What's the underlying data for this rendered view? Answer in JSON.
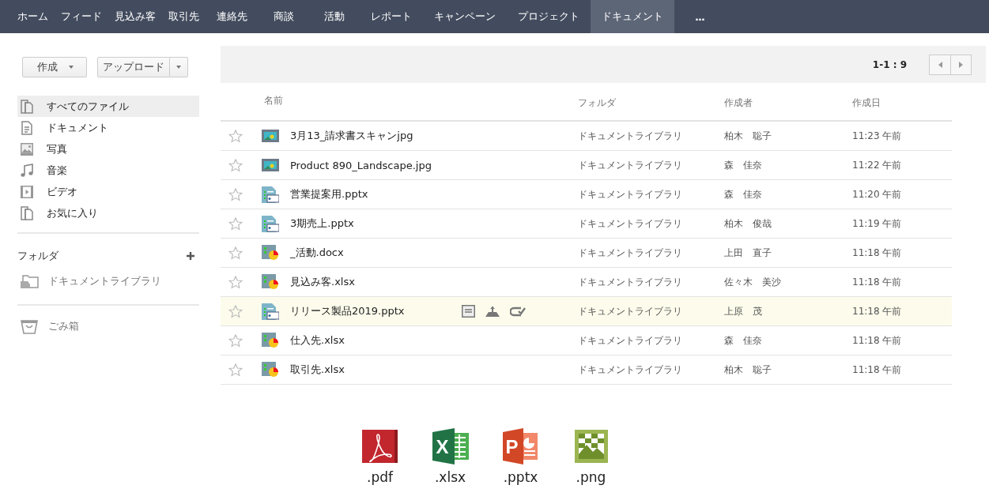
{
  "nav": {
    "items": [
      {
        "label": "ホーム",
        "selected": false
      },
      {
        "label": "フィード",
        "selected": false
      },
      {
        "label": "見込み客",
        "selected": false
      },
      {
        "label": "取引先",
        "selected": false
      },
      {
        "label": "連絡先",
        "selected": false
      },
      {
        "label": "商談",
        "selected": false
      },
      {
        "label": "活動",
        "selected": false
      },
      {
        "label": "レポート",
        "selected": false
      },
      {
        "label": "キャンペーン",
        "selected": false
      },
      {
        "label": "プロジェクト",
        "selected": false
      },
      {
        "label": "ドキュメント",
        "selected": true
      }
    ],
    "more": "..."
  },
  "sidebar": {
    "create_button": "作成",
    "upload_button": "アップロード",
    "items": [
      {
        "label": "すべてのファイル",
        "kind": "files",
        "selected": true
      },
      {
        "label": "ドキュメント",
        "kind": "document",
        "selected": false
      },
      {
        "label": "写真",
        "kind": "photo",
        "selected": false
      },
      {
        "label": "音楽",
        "kind": "music",
        "selected": false
      },
      {
        "label": "ビデオ",
        "kind": "video",
        "selected": false
      },
      {
        "label": "お気に入り",
        "kind": "favorites",
        "selected": false
      }
    ],
    "folders_heading": "フォルダ",
    "folders": [
      {
        "label": "ドキュメントライブラリ"
      }
    ],
    "trash": "ごみ箱"
  },
  "pager": {
    "range": "1-1 : 9"
  },
  "table": {
    "columns": [
      "名前",
      "フォルダ",
      "作成者",
      "作成日"
    ],
    "rows": [
      {
        "name": "3月13_請求書スキャンjpg",
        "kind": "image",
        "folder": "ドキュメントライブラリ",
        "owner": "柏木　聡子",
        "date": "11:23 午前",
        "starred": false,
        "selected": false
      },
      {
        "name": "Product 890_Landscape.jpg",
        "kind": "image",
        "folder": "ドキュメントライブラリ",
        "owner": "森　佳奈",
        "date": "11:22 午前",
        "starred": false,
        "selected": false
      },
      {
        "name": "営業提案用.pptx",
        "kind": "slides",
        "folder": "ドキュメントライブラリ",
        "owner": "森　佳奈",
        "date": "11:20 午前",
        "starred": false,
        "selected": false
      },
      {
        "name": "3期売上.pptx",
        "kind": "slides",
        "folder": "ドキュメントライブラリ",
        "owner": "柏木　俊哉",
        "date": "11:19 午前",
        "starred": false,
        "selected": false
      },
      {
        "name": "_活動.docx",
        "kind": "chart",
        "folder": "ドキュメントライブラリ",
        "owner": "上田　直子",
        "date": "11:18 午前",
        "starred": false,
        "selected": false
      },
      {
        "name": "見込み客.xlsx",
        "kind": "chart",
        "folder": "ドキュメントライブラリ",
        "owner": "佐々木　美沙",
        "date": "11:18 午前",
        "starred": false,
        "selected": false
      },
      {
        "name": "リリース製品2019.pptx",
        "kind": "slides",
        "folder": "ドキュメントライブラリ",
        "owner": "上原　茂",
        "date": "11:18 午前",
        "starred": false,
        "selected": true
      },
      {
        "name": "仕入先.xlsx",
        "kind": "chart",
        "folder": "ドキュメントライブラリ",
        "owner": "森　佳奈",
        "date": "11:18 午前",
        "starred": false,
        "selected": false
      },
      {
        "name": "取引先.xlsx",
        "kind": "chart",
        "folder": "ドキュメントライブラリ",
        "owner": "柏木　聡子",
        "date": "11:18 午前",
        "starred": false,
        "selected": false
      }
    ]
  },
  "file_types": [
    {
      "kind": "pdf",
      "label": ".pdf"
    },
    {
      "kind": "xlsx",
      "letter": "X",
      "label": ".xlsx"
    },
    {
      "kind": "pptx",
      "letter": "P",
      "label": ".pptx"
    },
    {
      "kind": "png",
      "label": ".png"
    }
  ]
}
